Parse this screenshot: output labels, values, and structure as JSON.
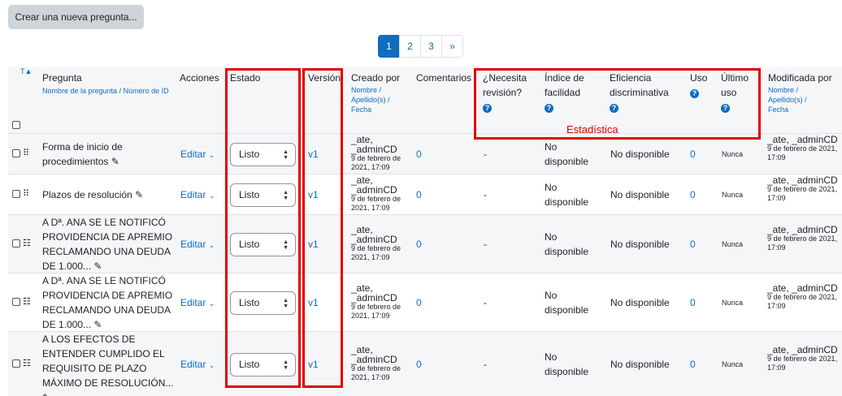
{
  "create_button": "Crear una nueva pregunta...",
  "pagination": [
    "1",
    "2",
    "3",
    "»"
  ],
  "header": {
    "sort_icon": "T",
    "pregunta": "Pregunta",
    "pregunta_sub_1": "Nombre de la pregunta",
    "pregunta_sub_sep": " / ",
    "pregunta_sub_2": "Número de ID",
    "acciones": "Acciones",
    "estado": "Estado",
    "version": "Versión",
    "creado_por": "Creado por",
    "creado_sub_1": "Nombre",
    "creado_sub_2": "Apellido(s)",
    "creado_sub_3": "Fecha",
    "comentarios": "Comentarios",
    "necesita": "¿Necesita revisión?",
    "indice": "Índice de facilidad",
    "eficiencia": "Eficiencia discriminativa",
    "uso": "Uso",
    "ultimo": "Último uso",
    "modificada": "Modificada por",
    "mod_sub_1": "Nombre",
    "mod_sub_2": "Apellido(s)",
    "mod_sub_3": "Fecha",
    "help_glyph": "?"
  },
  "annotation_label": "Estadística",
  "rows": [
    {
      "name": "Forma de inicio de procedimientos",
      "icon": "multichoice-icon",
      "action": "Editar",
      "status": "Listo",
      "version": "v1",
      "creator": "_ate, _adminCD",
      "date": "9 de febrero de 2021, 17:09",
      "comments": "0",
      "review": "-",
      "facility": "No disponible",
      "discrimination": "No disponible",
      "usage": "0",
      "last_used": "Nunca",
      "modifier": "_ate, _adminCD",
      "mod_date": "9 de febrero de 2021, 17:09"
    },
    {
      "name": "Plazos de resolución",
      "icon": "multichoice-icon",
      "action": "Editar",
      "status": "Listo",
      "version": "v1",
      "creator": "_ate, _adminCD",
      "date": "9 de febrero de 2021, 17:09",
      "comments": "0",
      "review": "-",
      "facility": "No disponible",
      "discrimination": "No disponible",
      "usage": "0",
      "last_used": "Nunca",
      "modifier": "_ate, _adminCD",
      "mod_date": "9 de febrero de 2021, 17:09"
    },
    {
      "name": "A Dª. ANA SE LE NOTIFICÓ PROVIDENCIA DE APREMIO RECLAMANDO UNA DEUDA DE 1.000...",
      "icon": "list-icon",
      "action": "Editar",
      "status": "Listo",
      "version": "v1",
      "creator": "_ate, _adminCD",
      "date": "9 de febrero de 2021, 17:09",
      "comments": "0",
      "review": "-",
      "facility": "No disponible",
      "discrimination": "No disponible",
      "usage": "0",
      "last_used": "Nunca",
      "modifier": "_ate, _adminCD",
      "mod_date": "9 de febrero de 2021, 17:09"
    },
    {
      "name": "A Dª. ANA SE LE NOTIFICÓ PROVIDENCIA DE APREMIO RECLAMANDO UNA DEUDA DE 1.000...",
      "icon": "list-icon",
      "action": "Editar",
      "status": "Listo",
      "version": "v1",
      "creator": "_ate, _adminCD",
      "date": "9 de febrero de 2021, 17:09",
      "comments": "0",
      "review": "-",
      "facility": "No disponible",
      "discrimination": "No disponible",
      "usage": "0",
      "last_used": "Nunca",
      "modifier": "_ate, _adminCD",
      "mod_date": "9 de febrero de 2021, 17:09"
    },
    {
      "name": "A LOS EFECTOS DE ENTENDER CUMPLIDO EL REQUISITO DE PLAZO MÁXIMO DE RESOLUCIÓN...",
      "icon": "list-icon",
      "action": "Editar",
      "status": "Listo",
      "version": "v1",
      "creator": "_ate, _adminCD",
      "date": "9 de febrero de 2021, 17:09",
      "comments": "0",
      "review": "-",
      "facility": "No disponible",
      "discrimination": "No disponible",
      "usage": "0",
      "last_used": "Nunca",
      "modifier": "_ate, _adminCD",
      "mod_date": "9 de febrero de 2021, 17:09"
    }
  ],
  "colors": {
    "link": "#0f6cbf",
    "annotation": "#e00000",
    "header_bg": "#f5f6f8"
  }
}
